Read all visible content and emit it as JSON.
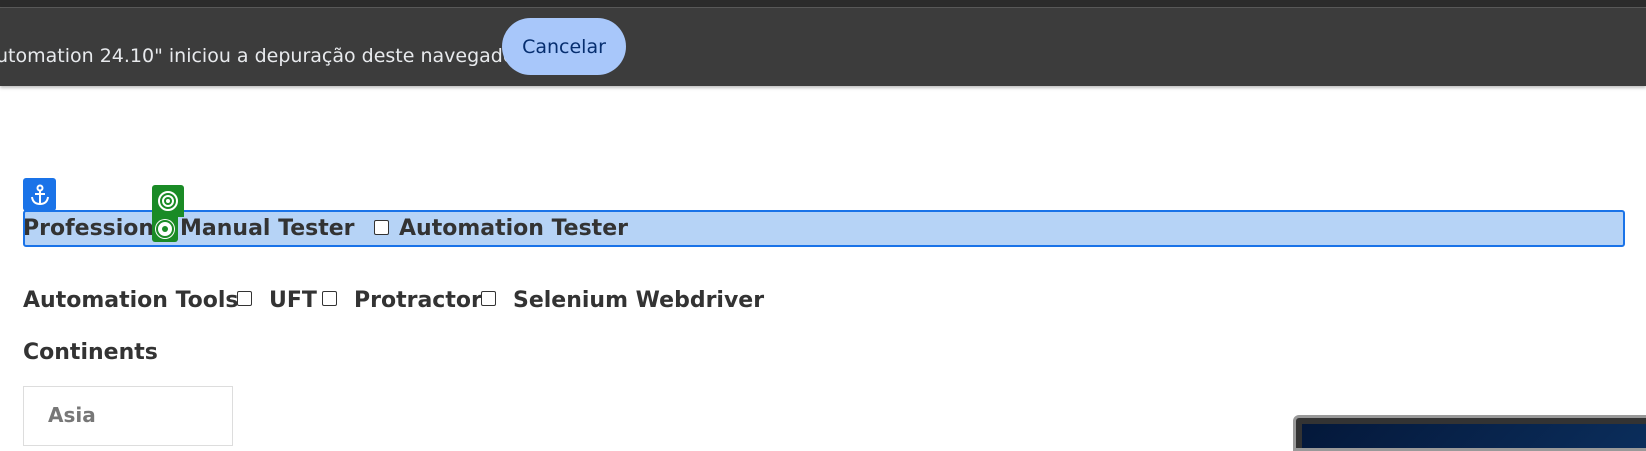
{
  "infobar": {
    "message": "utomation 24.10\" iniciou a depuração deste navegador.",
    "cancel_label": "Cancelar"
  },
  "profession": {
    "label": "Profession",
    "options": [
      {
        "label": "Manual Tester",
        "type": "radio",
        "checked": true
      },
      {
        "label": "Automation Tester",
        "type": "checkbox",
        "checked": false
      }
    ]
  },
  "automation_tools": {
    "label": "Automation Tools",
    "options": [
      {
        "label": "UFT",
        "checked": false
      },
      {
        "label": "Protractor",
        "checked": false
      },
      {
        "label": "Selenium Webdriver",
        "checked": false
      }
    ]
  },
  "continents": {
    "label": "Continents",
    "items": [
      "Asia"
    ]
  },
  "icons": {
    "anchor": "anchor-icon",
    "target": "target-icon"
  },
  "colors": {
    "highlight_blue": "#1a73e8",
    "highlight_fill": "#b6d3f6",
    "highlight_green": "#1a8b26",
    "infobar_bg": "#3c3c3c",
    "button_bg": "#a8c7fa"
  }
}
